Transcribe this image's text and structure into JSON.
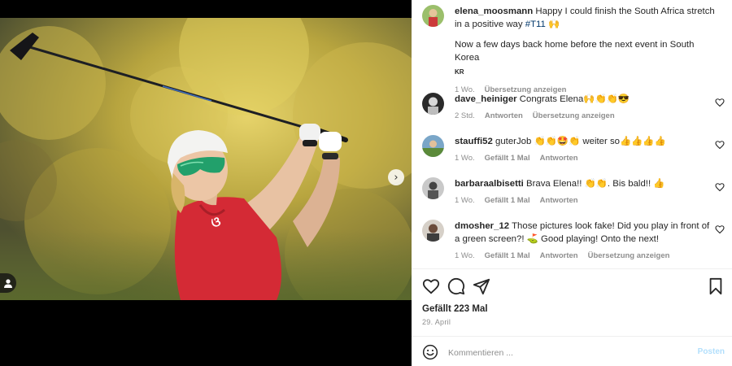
{
  "post": {
    "author": "elena_moosmann",
    "caption_part1": "Happy I could finish the South Africa stretch in a positive way ",
    "hashtag": "#T11",
    "caption_emoji": "🙌",
    "caption_part2": "Now a few days back home before the next event in South Korea",
    "caption_flag": "KR",
    "time": "1 Wo.",
    "translate": "Übersetzung anzeigen"
  },
  "comments": [
    {
      "user": "dave_heiniger",
      "text": "Congrats Elena🙌👏👏😎",
      "time": "2 Std.",
      "likes": "",
      "reply": "Antworten",
      "translate": "Übersetzung anzeigen"
    },
    {
      "user": "stauffi52",
      "text": "guterJob 👏👏🤩👏 weiter so👍👍👍👍",
      "time": "1 Wo.",
      "likes": "Gefällt 1 Mal",
      "reply": "Antworten",
      "translate": ""
    },
    {
      "user": "barbaraalbisetti",
      "text": "Brava Elena!! 👏👏. Bis bald!! 👍",
      "time": "1 Wo.",
      "likes": "Gefällt 1 Mal",
      "reply": "Antworten",
      "translate": ""
    },
    {
      "user": "dmosher_12",
      "text": "Those pictures look fake! Did you play in front of a green screen?! ⛳ Good playing! Onto the next!",
      "time": "1 Wo.",
      "likes": "Gefällt 1 Mal",
      "reply": "Antworten",
      "translate": "Übersetzung anzeigen"
    }
  ],
  "footer": {
    "likes": "Gefällt 223 Mal",
    "date": "29. April",
    "comment_placeholder": "Kommentieren ...",
    "post_label": "Posten"
  },
  "carousel": {
    "slides": 4,
    "active_slide": 1
  },
  "colors": {
    "shirt": "#d42a35",
    "link": "#00376b",
    "meta": "#8e8e8e",
    "post_disabled": "#b2dffc"
  },
  "icons": [
    "tag-user-icon",
    "chevron-right-icon",
    "heart-icon",
    "comment-icon",
    "share-icon",
    "bookmark-icon",
    "emoji-icon"
  ]
}
